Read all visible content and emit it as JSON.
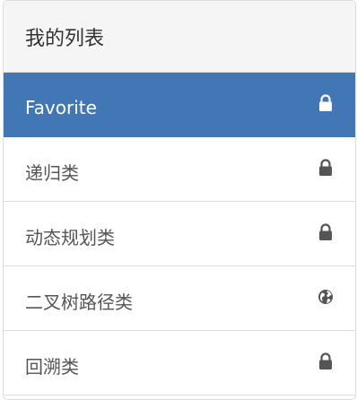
{
  "panel": {
    "title": "我的列表"
  },
  "list": {
    "items": [
      {
        "label": "Favorite",
        "icon": "lock-icon",
        "active": true
      },
      {
        "label": "递归类",
        "icon": "lock-icon",
        "active": false
      },
      {
        "label": "动态规划类",
        "icon": "lock-icon",
        "active": false
      },
      {
        "label": "二叉树路径类",
        "icon": "globe-icon",
        "active": false
      },
      {
        "label": "回溯类",
        "icon": "lock-icon",
        "active": false
      }
    ]
  },
  "colors": {
    "active_background": "#4277b6",
    "header_background": "#f5f5f5",
    "icon_dark": "#555555",
    "border": "#dddddd"
  }
}
